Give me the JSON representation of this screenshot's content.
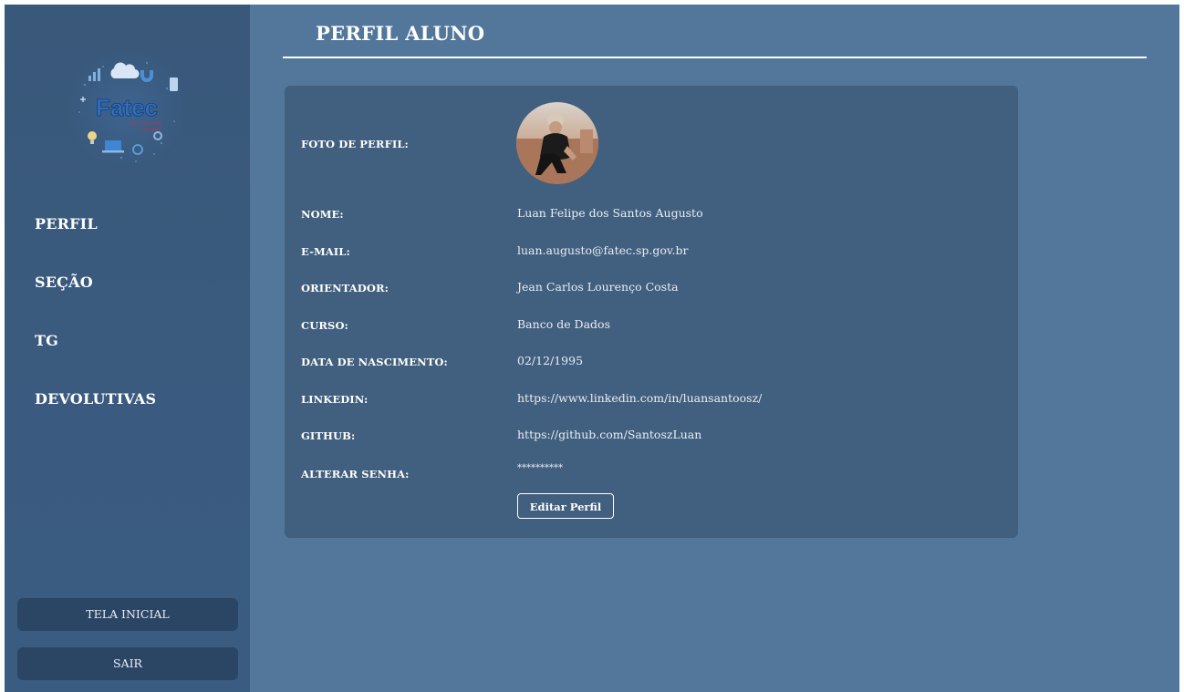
{
  "sidebar": {
    "logo_text": "Fatec",
    "nav": [
      {
        "label": "PERFIL"
      },
      {
        "label": "SEÇÃO"
      },
      {
        "label": "TG"
      },
      {
        "label": "DEVOLUTIVAS"
      }
    ],
    "home_button": "TELA INICIAL",
    "exit_button": "SAIR"
  },
  "header": {
    "title": "PERFIL ALUNO"
  },
  "profile": {
    "photo_label": "FOTO DE PERFIL:",
    "fields": [
      {
        "label": "NOME:",
        "value": "Luan Felipe dos Santos Augusto"
      },
      {
        "label": "E-MAIL:",
        "value": "luan.augusto@fatec.sp.gov.br"
      },
      {
        "label": "ORIENTADOR:",
        "value": "Jean Carlos Lourenço Costa"
      },
      {
        "label": "CURSO:",
        "value": "Banco de Dados"
      },
      {
        "label": "DATA DE NASCIMENTO:",
        "value": "02/12/1995"
      },
      {
        "label": "LINKEDIN:",
        "value": "https://www.linkedin.com/in/luansantoosz/"
      },
      {
        "label": "GITHUB:",
        "value": "https://github.com/SantoszLuan"
      },
      {
        "label": "ALTERAR SENHA:",
        "value": "**********"
      }
    ],
    "edit_button": "Editar Perfil"
  },
  "colors": {
    "background": "#52779b",
    "sidebar": "#3a5b7f",
    "card": "#415f7e",
    "side_button": "#2b4564"
  }
}
